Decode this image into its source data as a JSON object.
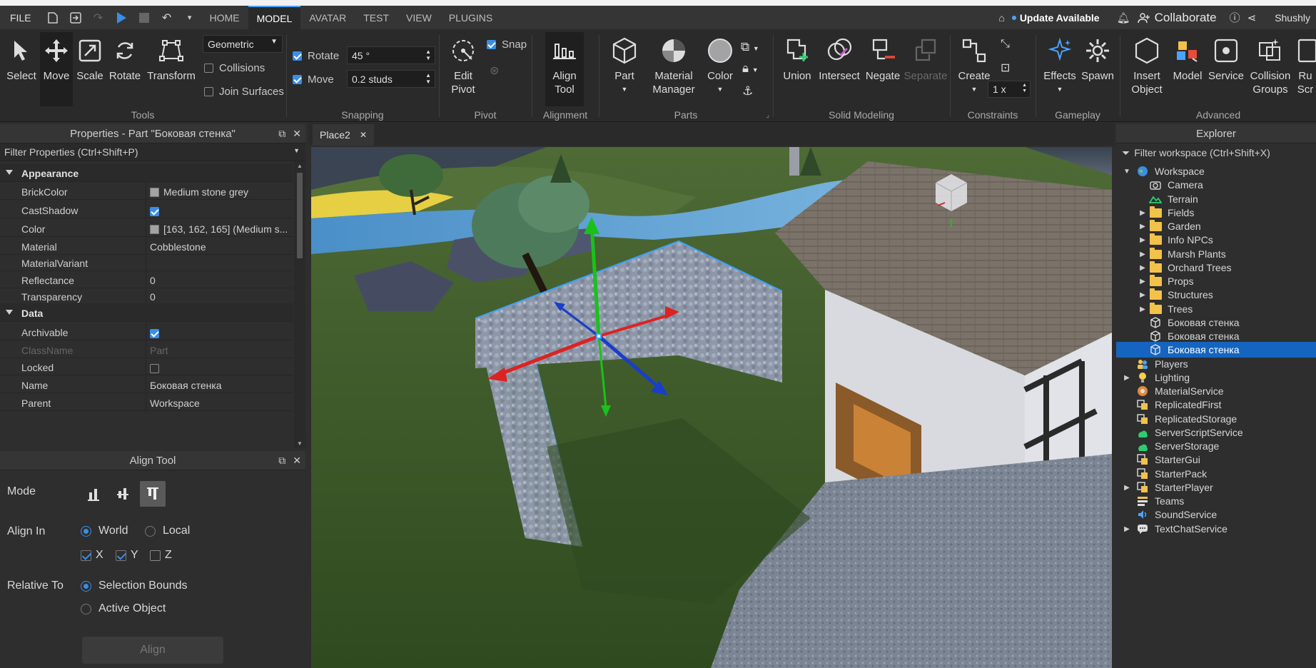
{
  "menubar": {
    "file": "FILE",
    "tabs": [
      "HOME",
      "MODEL",
      "AVATAR",
      "TEST",
      "VIEW",
      "PLUGINS"
    ],
    "active_tab": "MODEL",
    "update": "Update Available",
    "collaborate": "Collaborate",
    "user": "Shushly"
  },
  "ribbon": {
    "tools": {
      "label": "Tools",
      "select": "Select",
      "move": "Move",
      "scale": "Scale",
      "rotate": "Rotate",
      "transform": "Transform",
      "mode": "Geometric",
      "collisions": "Collisions",
      "join_surfaces": "Join Surfaces"
    },
    "snapping": {
      "label": "Snapping",
      "rotate": "Rotate",
      "rotate_value": "45 °",
      "move": "Move",
      "move_value": "0.2 studs"
    },
    "pivot": {
      "label": "Pivot",
      "edit_pivot_1": "Edit",
      "edit_pivot_2": "Pivot",
      "snap": "Snap"
    },
    "alignment": {
      "label": "Alignment",
      "align_tool_1": "Align",
      "align_tool_2": "Tool"
    },
    "parts": {
      "label": "Parts",
      "part": "Part",
      "material_manager_1": "Material",
      "material_manager_2": "Manager",
      "color": "Color"
    },
    "solid": {
      "label": "Solid Modeling",
      "union": "Union",
      "intersect": "Intersect",
      "negate": "Negate",
      "separate": "Separate"
    },
    "constraints": {
      "label": "Constraints",
      "create": "Create",
      "scale": "1 x"
    },
    "gameplay": {
      "label": "Gameplay",
      "effects": "Effects",
      "spawn": "Spawn"
    },
    "advanced": {
      "label": "Advanced",
      "insert_object_1": "Insert",
      "insert_object_2": "Object",
      "model": "Model",
      "service": "Service",
      "collision_groups_1": "Collision",
      "collision_groups_2": "Groups",
      "run_1": "Ru",
      "run_2": "Scr"
    }
  },
  "properties": {
    "title": "Properties - Part \"Боковая стенка\"",
    "filter": "Filter Properties (Ctrl+Shift+P)",
    "rows": [
      {
        "type": "cat",
        "name": "Appearance"
      },
      {
        "name": "BrickColor",
        "value": "Medium stone grey",
        "swatch": "#a3a2a5"
      },
      {
        "name": "CastShadow",
        "check": true
      },
      {
        "name": "Color",
        "value": "[163, 162, 165] (Medium s...",
        "swatch": "#a3a2a5"
      },
      {
        "name": "Material",
        "value": "Cobblestone"
      },
      {
        "name": "MaterialVariant",
        "value": ""
      },
      {
        "name": "Reflectance",
        "value": "0"
      },
      {
        "name": "Transparency",
        "value": "0"
      },
      {
        "type": "cat",
        "name": "Data"
      },
      {
        "name": "Archivable",
        "check": true
      },
      {
        "name": "ClassName",
        "value": "Part",
        "disabled": true
      },
      {
        "name": "Locked",
        "check": false
      },
      {
        "name": "Name",
        "value": "Боковая стенка"
      },
      {
        "name": "Parent",
        "value": "Workspace"
      }
    ]
  },
  "align_tool": {
    "title": "Align Tool",
    "mode": "Mode",
    "align_in": "Align In",
    "world": "World",
    "local": "Local",
    "x": "X",
    "y": "Y",
    "z": "Z",
    "relative_to": "Relative To",
    "selection_bounds": "Selection Bounds",
    "active_object": "Active Object",
    "align_button": "Align"
  },
  "viewport": {
    "tab": "Place2"
  },
  "explorer": {
    "title": "Explorer",
    "filter": "Filter workspace (Ctrl+Shift+X)",
    "items": [
      {
        "label": "Workspace",
        "arrow": "▼",
        "icon": "globe",
        "indent": 0
      },
      {
        "label": "Camera",
        "icon": "camera",
        "indent": 1
      },
      {
        "label": "Terrain",
        "icon": "terrain",
        "indent": 1
      },
      {
        "label": "Fields",
        "arrow": "▶",
        "icon": "folder",
        "indent": 1
      },
      {
        "label": "Garden",
        "arrow": "▶",
        "icon": "folder",
        "indent": 1
      },
      {
        "label": "Info NPCs",
        "arrow": "▶",
        "icon": "folder",
        "indent": 1
      },
      {
        "label": "Marsh Plants",
        "arrow": "▶",
        "icon": "folder",
        "indent": 1
      },
      {
        "label": "Orchard Trees",
        "arrow": "▶",
        "icon": "folder",
        "indent": 1
      },
      {
        "label": "Props",
        "arrow": "▶",
        "icon": "folder",
        "indent": 1
      },
      {
        "label": "Structures",
        "arrow": "▶",
        "icon": "folder",
        "indent": 1
      },
      {
        "label": "Trees",
        "arrow": "▶",
        "icon": "folder",
        "indent": 1
      },
      {
        "label": "Боковая стенка",
        "icon": "part",
        "indent": 1
      },
      {
        "label": "Боковая стенка",
        "icon": "part",
        "indent": 1
      },
      {
        "label": "Боковая стенка",
        "icon": "part",
        "indent": 1,
        "selected": true
      },
      {
        "label": "Players",
        "icon": "players",
        "indent": 0
      },
      {
        "label": "Lighting",
        "arrow": "▶",
        "icon": "lighting",
        "indent": 0
      },
      {
        "label": "MaterialService",
        "icon": "material",
        "indent": 0
      },
      {
        "label": "ReplicatedFirst",
        "icon": "replicated",
        "indent": 0
      },
      {
        "label": "ReplicatedStorage",
        "icon": "replicated",
        "indent": 0
      },
      {
        "label": "ServerScriptService",
        "icon": "server",
        "indent": 0
      },
      {
        "label": "ServerStorage",
        "icon": "server",
        "indent": 0
      },
      {
        "label": "StarterGui",
        "icon": "starter",
        "indent": 0
      },
      {
        "label": "StarterPack",
        "icon": "starter",
        "indent": 0
      },
      {
        "label": "StarterPlayer",
        "arrow": "▶",
        "icon": "starter",
        "indent": 0
      },
      {
        "label": "Teams",
        "icon": "teams",
        "indent": 0
      },
      {
        "label": "SoundService",
        "icon": "sound",
        "indent": 0
      },
      {
        "label": "TextChatService",
        "arrow": "▶",
        "icon": "chat",
        "indent": 0
      }
    ]
  }
}
